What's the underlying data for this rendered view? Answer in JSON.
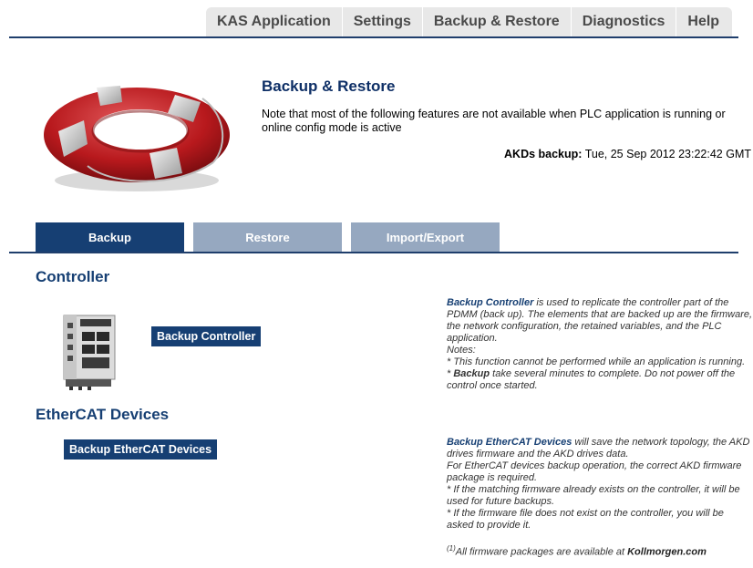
{
  "topnav": {
    "items": [
      "KAS Application",
      "Settings",
      "Backup & Restore",
      "Diagnostics",
      "Help"
    ]
  },
  "hero": {
    "title": "Backup & Restore",
    "note": "Note that most of the following features are not available when PLC application is running or online config mode is active",
    "akd_label": "AKDs backup:",
    "akd_value": "Tue, 25 Sep 2012 23:22:42 GMT"
  },
  "tabs": [
    "Backup",
    "Restore",
    "Import/Export"
  ],
  "controller": {
    "title": "Controller",
    "button": "Backup Controller",
    "desc": {
      "lead_bold": "Backup Controller",
      "lead_rest": " is used to replicate the controller part of the PDMM (back up). The elements that are backed up are the firmware, the network configuration, the retained variables, and the PLC application.",
      "notes": "Notes:",
      "note1": "* This function cannot be performed while an application is running.",
      "note2_prefix": "* ",
      "note2_bold": "Backup",
      "note2_rest": " take several minutes to complete. Do not power off the control once started."
    }
  },
  "ethercat": {
    "title": "EtherCAT Devices",
    "button": "Backup EtherCAT Devices",
    "desc": {
      "lead_bold": "Backup EtherCAT Devices",
      "lead_rest": " will save the network topology, the AKD drives firmware and the AKD drives data.",
      "line2": "For EtherCAT devices backup operation, the correct AKD firmware package is required.",
      "line3": "* If the matching firmware already exists on the controller, it will be used for future backups.",
      "line4": "* If the firmware file does not exist on the controller, you will be asked to provide it.",
      "footnote_sup": "(1)",
      "footnote_text": "All firmware packages are available at ",
      "footnote_link": "Kollmorgen.com"
    }
  },
  "colors": {
    "primary": "#163f73",
    "tab_inactive": "#96a8c0",
    "nav_bg": "#e8e8e8"
  }
}
